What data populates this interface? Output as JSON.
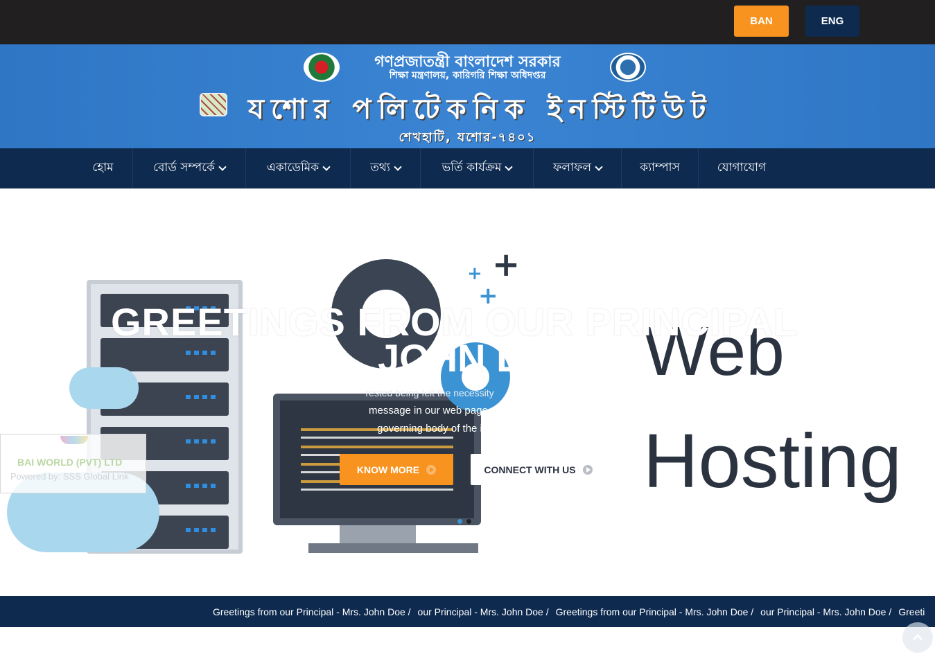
{
  "language_switch": {
    "ban_label": "BAN",
    "eng_label": "ENG",
    "active": "BAN"
  },
  "banner": {
    "gov_title": "গণপ্রজাতন্ত্রী বাংলাদেশ সরকার",
    "gov_subtitle": "শিক্ষা মন্ত্রণালয়, কারিগরি শিক্ষা অধিদপ্তর",
    "institute_name": "যশোর পলিটেকনিক ইনস্টিটিউট",
    "address": "শেখহাটি, যশোর-৭৪০১"
  },
  "nav": {
    "items": [
      {
        "label": "হোম",
        "has_dropdown": false
      },
      {
        "label": "বোর্ড সম্পর্কে",
        "has_dropdown": true
      },
      {
        "label": "একাডেমিক",
        "has_dropdown": true
      },
      {
        "label": "তথ্য",
        "has_dropdown": true
      },
      {
        "label": "ভর্তি কার্যক্রম",
        "has_dropdown": true
      },
      {
        "label": "ফলাফল",
        "has_dropdown": true
      },
      {
        "label": "ক্যাম্পাস",
        "has_dropdown": false
      },
      {
        "label": "যোগাযোগ",
        "has_dropdown": false
      }
    ]
  },
  "hero": {
    "title": "GREETINGS FROM OUR PRINCIPAL",
    "name": "JOHN DOE",
    "body_line_1": "rested being felt the necessity",
    "body_line_2": "message in our web page,",
    "body_line_3": "governing body of the i",
    "know_more_label": "KNOW MORE",
    "connect_label": "CONNECT WITH US",
    "background_text_1": "Web",
    "background_text_2": "Hosting",
    "slide_count": 2,
    "active_slide": 2
  },
  "watermark": {
    "company": "BAI WORLD (PVT) LTD",
    "powered_by": "Powered by: SSS Global Link"
  },
  "ticker": {
    "items": [
      "Greetings from our Principal - Mrs. John Doe /",
      "our Principal - Mrs. John Doe /",
      "Greetings from our Principal - Mrs. John Doe /",
      "our Principal - Mrs. John Doe /",
      "Greeti"
    ]
  },
  "colors": {
    "topbar": "#221f20",
    "accent_orange": "#f7931e",
    "navy": "#0e2a4f",
    "banner_blue": "#3a84d3"
  },
  "icons": [
    "chevron-down-icon",
    "play-circle-icon",
    "chevron-up-icon",
    "bangladesh-emblem",
    "teb-logo",
    "institute-logo"
  ]
}
